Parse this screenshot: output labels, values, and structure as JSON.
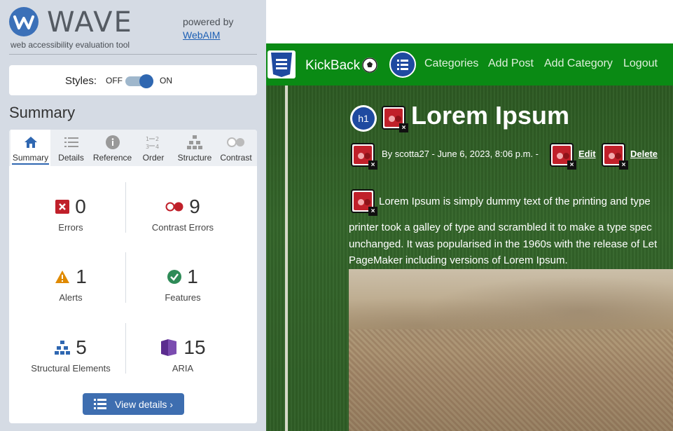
{
  "wave": {
    "logo_text": "WAVE",
    "tagline": "web accessibility evaluation tool",
    "powered_by": "powered by",
    "webaim_link": "WebAIM",
    "styles": {
      "label": "Styles:",
      "off": "OFF",
      "on": "ON",
      "state": "on"
    },
    "summary_heading": "Summary",
    "tabs": [
      {
        "label": "Summary",
        "icon": "home-icon",
        "active": true
      },
      {
        "label": "Details",
        "icon": "list-icon",
        "active": false
      },
      {
        "label": "Reference",
        "icon": "info-icon",
        "active": false
      },
      {
        "label": "Order",
        "icon": "order-icon",
        "active": false
      },
      {
        "label": "Structure",
        "icon": "structure-icon",
        "active": false
      },
      {
        "label": "Contrast",
        "icon": "contrast-icon",
        "active": false
      }
    ],
    "stats": {
      "errors": {
        "value": "0",
        "label": "Errors"
      },
      "contrast_errors": {
        "value": "9",
        "label": "Contrast Errors"
      },
      "alerts": {
        "value": "1",
        "label": "Alerts"
      },
      "features": {
        "value": "1",
        "label": "Features"
      },
      "structural": {
        "value": "5",
        "label": "Structural Elements"
      },
      "aria": {
        "value": "15",
        "label": "ARIA"
      }
    },
    "view_details": "View details ›",
    "colors": {
      "accent": "#2f67b1",
      "error": "#c0202a",
      "alert": "#e08a00",
      "feature": "#2e8b57",
      "aria": "#5b2c8f"
    }
  },
  "page": {
    "nav": {
      "brand": "KickBack",
      "links": [
        "Categories",
        "Add Post",
        "Add Category",
        "Logout"
      ],
      "color": "#0a8a14"
    },
    "h1_badge": "h1",
    "post": {
      "title": "Lorem Ipsum",
      "byline": "By scotta27 - June 6, 2023, 8:06 p.m. -",
      "edit": "Edit",
      "delete": "Delete",
      "lines": [
        "Lorem Ipsum is simply dummy text of the printing and type",
        "printer took a galley of type and scrambled it to make a type spec",
        "unchanged. It was popularised in the 1960s with the release of Let",
        "PageMaker including versions of Lorem Ipsum."
      ]
    }
  }
}
